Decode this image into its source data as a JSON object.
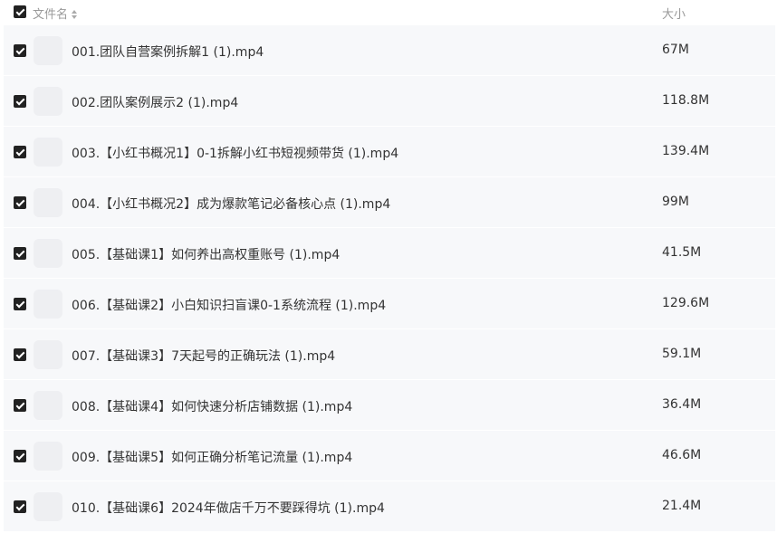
{
  "header": {
    "name_label": "文件名",
    "size_label": "大小"
  },
  "rows": [
    {
      "name": "001.团队自营案例拆解1 (1).mp4",
      "size": "67M"
    },
    {
      "name": "002.团队案例展示2 (1).mp4",
      "size": "118.8M"
    },
    {
      "name": "003.【小红书概况1】0-1拆解小红书短视频带货 (1).mp4",
      "size": "139.4M"
    },
    {
      "name": "004.【小红书概况2】成为爆款笔记必备核心点 (1).mp4",
      "size": "99M"
    },
    {
      "name": "005.【基础课1】如何养出高权重账号 (1).mp4",
      "size": "41.5M"
    },
    {
      "name": "006.【基础课2】小白知识扫盲课0-1系统流程 (1).mp4",
      "size": "129.6M"
    },
    {
      "name": "007.【基础课3】7天起号的正确玩法 (1).mp4",
      "size": "59.1M"
    },
    {
      "name": "008.【基础课4】如何快速分析店铺数据 (1).mp4",
      "size": "36.4M"
    },
    {
      "name": "009.【基础课5】如何正确分析笔记流量 (1).mp4",
      "size": "46.6M"
    },
    {
      "name": "010.【基础课6】2024年做店千万不要踩得坑 (1).mp4",
      "size": "21.4M"
    }
  ]
}
